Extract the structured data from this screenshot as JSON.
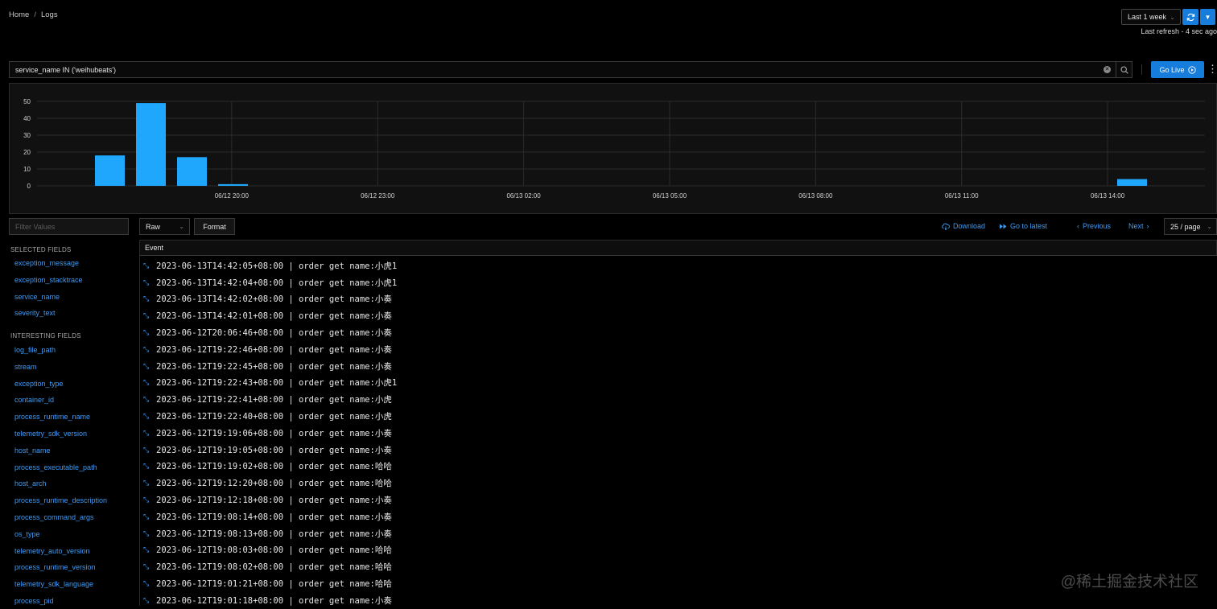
{
  "breadcrumb": {
    "home": "Home",
    "separator": "/",
    "current": "Logs"
  },
  "time_range": {
    "selected": "Last 1 week",
    "last_refresh": "Last refresh - 4 sec ago"
  },
  "search": {
    "query": "service_name IN ('weihubeats')",
    "go_live_label": "Go Live"
  },
  "colors": {
    "accent": "#177ddc",
    "link": "#3e9bf5",
    "bar": "#1ea7fd"
  },
  "chart_data": {
    "type": "bar",
    "y_ticks": [
      "50",
      "40",
      "30",
      "20",
      "10",
      "0"
    ],
    "x_ticks": [
      "06/12 20:00",
      "06/12 23:00",
      "06/13 02:00",
      "06/13 05:00",
      "06/13 08:00",
      "06/13 11:00",
      "06/13 14:00"
    ],
    "x": [
      "06/12 19:00",
      "06/12 19:00",
      "06/12 19:00",
      "06/12 20:00",
      "06/13 14:00"
    ],
    "values": [
      18,
      49,
      17,
      1,
      4
    ],
    "ylim": [
      0,
      50
    ],
    "grid": true,
    "legend": false
  },
  "left_panel": {
    "filter_placeholder": "Filter Values",
    "selected_title": "SELECTED FIELDS",
    "selected_fields": [
      "exception_message",
      "exception_stacktrace",
      "service_name",
      "severity_text"
    ],
    "interesting_title": "INTERESTING FIELDS",
    "interesting_fields": [
      "log_file_path",
      "stream",
      "exception_type",
      "container_id",
      "process_runtime_name",
      "telemetry_sdk_version",
      "host_name",
      "process_executable_path",
      "host_arch",
      "process_runtime_description",
      "process_command_args",
      "os_type",
      "telemetry_auto_version",
      "process_runtime_version",
      "telemetry_sdk_language",
      "process_pid"
    ]
  },
  "toolbar": {
    "view_mode": "Raw",
    "format_label": "Format",
    "download_label": "Download",
    "go_to_latest_label": "Go to latest",
    "previous_label": "Previous",
    "next_label": "Next",
    "page_size": "25 / page"
  },
  "table": {
    "header": "Event",
    "rows": [
      "2023-06-13T14:42:05+08:00 | order get name:小虎1",
      "2023-06-13T14:42:04+08:00 | order get name:小虎1",
      "2023-06-13T14:42:02+08:00 | order get name:小奏",
      "2023-06-13T14:42:01+08:00 | order get name:小奏",
      "2023-06-12T20:06:46+08:00 | order get name:小奏",
      "2023-06-12T19:22:46+08:00 | order get name:小奏",
      "2023-06-12T19:22:45+08:00 | order get name:小奏",
      "2023-06-12T19:22:43+08:00 | order get name:小虎1",
      "2023-06-12T19:22:41+08:00 | order get name:小虎",
      "2023-06-12T19:22:40+08:00 | order get name:小虎",
      "2023-06-12T19:19:06+08:00 | order get name:小奏",
      "2023-06-12T19:19:05+08:00 | order get name:小奏",
      "2023-06-12T19:19:02+08:00 | order get name:哈哈",
      "2023-06-12T19:12:20+08:00 | order get name:哈哈",
      "2023-06-12T19:12:18+08:00 | order get name:小奏",
      "2023-06-12T19:08:14+08:00 | order get name:小奏",
      "2023-06-12T19:08:13+08:00 | order get name:小奏",
      "2023-06-12T19:08:03+08:00 | order get name:哈哈",
      "2023-06-12T19:08:02+08:00 | order get name:哈哈",
      "2023-06-12T19:01:21+08:00 | order get name:哈哈",
      "2023-06-12T19:01:18+08:00 | order get name:小奏"
    ]
  },
  "watermark": "@稀土掘金技术社区"
}
